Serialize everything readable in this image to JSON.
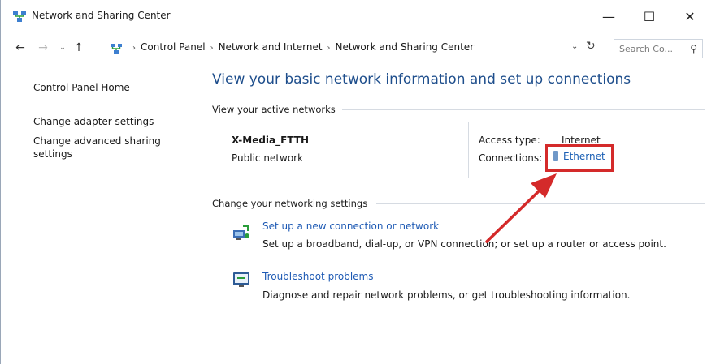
{
  "window": {
    "title": "Network and Sharing Center",
    "minimize_glyph": "—",
    "maximize_glyph": "☐",
    "close_glyph": "✕"
  },
  "address_bar": {
    "back_glyph": "←",
    "forward_glyph": "→",
    "recent_glyph": "⌄",
    "up_glyph": "↑",
    "separator": "›",
    "breadcrumbs": [
      "Control Panel",
      "Network and Internet",
      "Network and Sharing Center"
    ],
    "dropdown_glyph": "⌄",
    "refresh_glyph": "↻"
  },
  "search": {
    "placeholder": "Search Co...",
    "icon": "search-icon",
    "icon_glyph": "⚲"
  },
  "left_pane": {
    "items": [
      {
        "label": "Control Panel Home"
      },
      {
        "label": "Change adapter settings"
      },
      {
        "label": "Change advanced sharing settings"
      }
    ]
  },
  "main": {
    "title": "View your basic network information and set up connections",
    "active_networks": {
      "section_label": "View your active networks",
      "network_name": "X-Media_FTTH",
      "network_category": "Public network",
      "access_type_label": "Access type:",
      "access_type_value": "Internet",
      "connections_label": "Connections:",
      "connection_name": "Ethernet"
    },
    "change_settings": {
      "section_label": "Change your networking settings",
      "tasks": [
        {
          "icon": "network-setup-icon",
          "link": "Set up a new connection or network",
          "description": "Set up a broadband, dial-up, or VPN connection; or set up a router or access point."
        },
        {
          "icon": "troubleshoot-icon",
          "link": "Troubleshoot problems",
          "description": "Diagnose and repair network problems, or get troubleshooting information."
        }
      ]
    }
  },
  "annotation": {
    "highlight_color": "#d42a2a"
  },
  "colors": {
    "heading": "#1e4e8c",
    "link": "#1e5ab4",
    "text": "#1a1a1a"
  }
}
